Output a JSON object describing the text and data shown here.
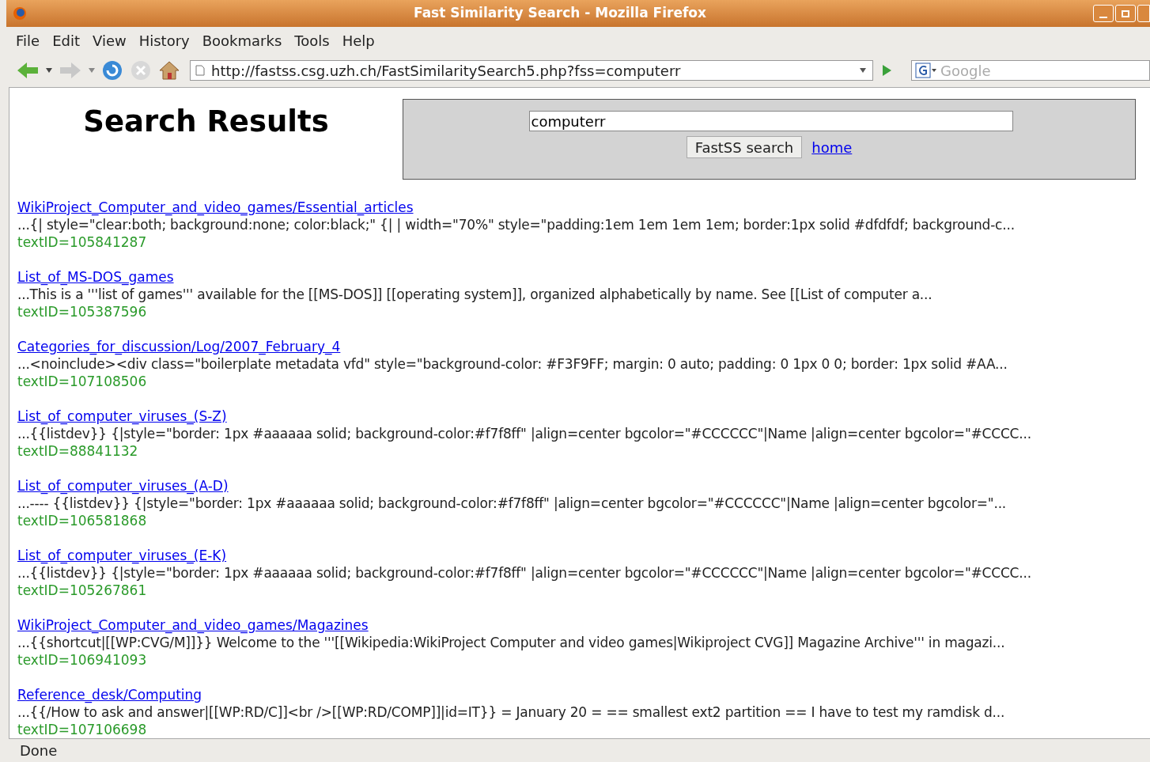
{
  "window": {
    "title": "Fast Similarity Search - Mozilla Firefox"
  },
  "menu": [
    "File",
    "Edit",
    "View",
    "History",
    "Bookmarks",
    "Tools",
    "Help"
  ],
  "toolbar": {
    "url": "http://fastss.csg.uzh.ch/FastSimilaritySearch5.php?fss=computerr",
    "search_placeholder": "Google"
  },
  "page": {
    "heading": "Search Results",
    "query": "computerr",
    "search_button": "FastSS search",
    "home_link": "home",
    "results": [
      {
        "title": "WikiProject_Computer_and_video_games/Essential_articles",
        "snippet": "...{| style=\"clear:both; background:none; color:black;\" {| | width=\"70%\" style=\"padding:1em 1em 1em 1em; border:1px solid #dfdfdf; background-c...",
        "text_id": "textID=105841287"
      },
      {
        "title": "List_of_MS-DOS_games",
        "snippet": "...This is a '''list of games''' available for the [[MS-DOS]] [[operating system]], organized alphabetically by name. See [[List of computer a...",
        "text_id": "textID=105387596"
      },
      {
        "title": "Categories_for_discussion/Log/2007_February_4",
        "snippet": "...<noinclude><div class=\"boilerplate metadata vfd\" style=\"background-color: #F3F9FF; margin: 0 auto; padding: 0 1px 0 0; border: 1px solid #AA...",
        "text_id": "textID=107108506"
      },
      {
        "title": "List_of_computer_viruses_(S-Z)",
        "snippet": "...{{listdev}} {|style=\"border: 1px #aaaaaa solid; background-color:#f7f8ff\" |align=center bgcolor=\"#CCCCCC\"|Name |align=center bgcolor=\"#CCCC...",
        "text_id": "textID=88841132"
      },
      {
        "title": "List_of_computer_viruses_(A-D)",
        "snippet": "...---- {{listdev}} {|style=\"border: 1px #aaaaaa solid; background-color:#f7f8ff\" |align=center bgcolor=\"#CCCCCC\"|Name |align=center bgcolor=\"...",
        "text_id": "textID=106581868"
      },
      {
        "title": "List_of_computer_viruses_(E-K)",
        "snippet": "...{{listdev}} {|style=\"border: 1px #aaaaaa solid; background-color:#f7f8ff\" |align=center bgcolor=\"#CCCCCC\"|Name |align=center bgcolor=\"#CCCC...",
        "text_id": "textID=105267861"
      },
      {
        "title": "WikiProject_Computer_and_video_games/Magazines",
        "snippet": "...{{shortcut|[[WP:CVG/M]]}} Welcome to the '''[[Wikipedia:WikiProject Computer and video games|Wikiproject CVG]] Magazine Archive''' in magazi...",
        "text_id": "textID=106941093"
      },
      {
        "title": "Reference_desk/Computing",
        "snippet": "...{{/How to ask and answer|[[WP:RD/C]]<br />[[WP:RD/COMP]]|id=IT}} = January 20 = == smallest ext2 partition == I have to test my ramdisk d...",
        "text_id": "textID=107106698"
      }
    ]
  },
  "status_bar": "Done"
}
